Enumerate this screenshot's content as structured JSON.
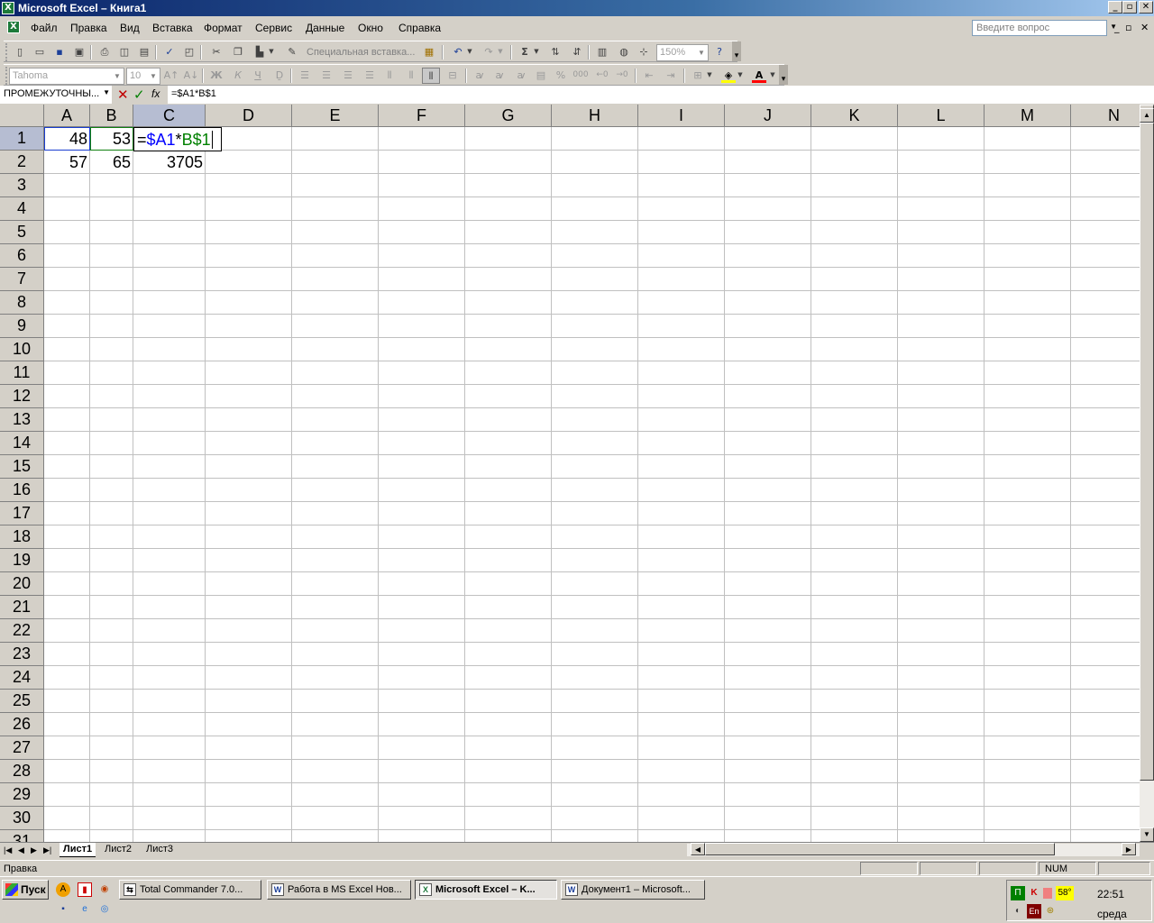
{
  "window": {
    "title": "Microsoft Excel – Книга1",
    "controls": [
      "_",
      "▫",
      "✕"
    ]
  },
  "menu": {
    "items": [
      "Файл",
      "Правка",
      "Вид",
      "Вставка",
      "Формат",
      "Сервис",
      "Данные",
      "Окно",
      "Справка"
    ],
    "ask_placeholder": "Введите вопрос"
  },
  "toolbar": {
    "paste_special_label": "Специальная вставка...",
    "zoom": "150%",
    "font_name": "Tahoma",
    "font_size": "10",
    "bold": "Ж",
    "italic": "К",
    "underline": "Ч",
    "percent": "%",
    "thousands": "000",
    "sigma": "Σ",
    "font_color_letter": "A"
  },
  "formula_bar": {
    "name_box": "ПРОМЕЖУТОЧНЫ...",
    "fx": "fx",
    "content": "=$A1*B$1"
  },
  "grid": {
    "columns": [
      "A",
      "B",
      "C",
      "D",
      "E",
      "F",
      "G",
      "H",
      "I",
      "J",
      "K",
      "L",
      "M",
      "N"
    ],
    "rows": [
      "1",
      "2",
      "3",
      "4",
      "5",
      "6",
      "7",
      "8",
      "9",
      "10",
      "11",
      "12",
      "13",
      "14",
      "15",
      "16",
      "17",
      "18",
      "19",
      "20",
      "21",
      "22",
      "23",
      "24",
      "25",
      "26",
      "27",
      "28",
      "29",
      "30",
      "31"
    ],
    "cells": {
      "A1": "48",
      "B1": "53",
      "A2": "57",
      "B2": "65",
      "C2": "3705"
    },
    "edit_cell": {
      "address": "C1",
      "eq": "=",
      "ref1": "$A1",
      "op": "*",
      "ref2": "B$1"
    }
  },
  "sheets": [
    "Лист1",
    "Лист2",
    "Лист3"
  ],
  "status": {
    "mode": "Правка",
    "num": "NUM"
  },
  "taskbar": {
    "start": "Пуск",
    "buttons": [
      {
        "label": "Total Commander 7.0...",
        "active": false
      },
      {
        "label": "Работа в  MS Excel Нов...",
        "active": false
      },
      {
        "label": "Microsoft Excel – K...",
        "active": true
      },
      {
        "label": "Документ1 – Microsoft...",
        "active": false
      }
    ],
    "tray_temp": "58°",
    "tray_lang": "En",
    "clock": "22:51",
    "day": "среда"
  }
}
